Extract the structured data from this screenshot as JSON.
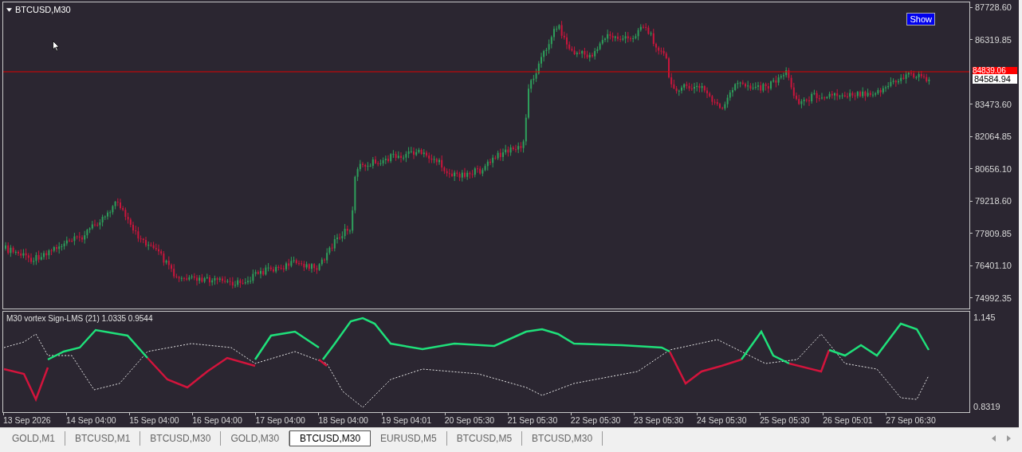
{
  "chart": {
    "title": "BTCUSD,M30",
    "show_button": "Show",
    "price_ticks": [
      "87728.60",
      "86319.85",
      "83473.60",
      "82064.85",
      "80656.10",
      "79218.60",
      "77809.85",
      "76401.10",
      "74992.35"
    ],
    "bid_label": "84839.06",
    "last_label": "84584.94"
  },
  "indicator": {
    "label": "M30 vortex Sign-LMS (21) 1.0335 0.9544",
    "max_label": "1.145",
    "min_label": "0.8319"
  },
  "time_axis": [
    "13 Sep 2026",
    "14 Sep 04:00",
    "15 Sep 04:00",
    "16 Sep 04:00",
    "17 Sep 04:00",
    "18 Sep 04:00",
    "19 Sep 04:01",
    "20 Sep 05:30",
    "21 Sep 05:30",
    "22 Sep 05:30",
    "23 Sep 05:30",
    "24 Sep 05:30",
    "25 Sep 05:30",
    "26 Sep 05:01",
    "27 Sep 06:30"
  ],
  "tabs": [
    {
      "label": "GOLD,M1",
      "selected": false
    },
    {
      "label": "BTCUSD,M1",
      "selected": false
    },
    {
      "label": "BTCUSD,M30",
      "selected": false
    },
    {
      "label": "GOLD,M30",
      "selected": false
    },
    {
      "label": "BTCUSD,M30",
      "selected": true
    },
    {
      "label": "EURUSD,M5",
      "selected": false
    },
    {
      "label": "BTCUSD,M5",
      "selected": false
    },
    {
      "label": "BTCUSD,M30",
      "selected": false
    }
  ]
}
